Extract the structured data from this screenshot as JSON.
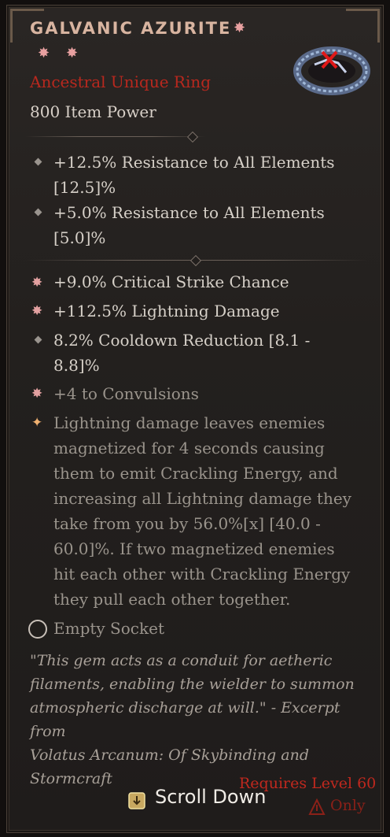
{
  "item": {
    "name": "GALVANIC AZURITE",
    "rarity": "Ancestral Unique Ring",
    "power": "800 Item Power"
  },
  "resistances": [
    {
      "line1": "+12.5% Resistance to All Elements",
      "line2": "[12.5]%"
    },
    {
      "line1": "+5.0% Resistance to All Elements",
      "line2": "[5.0]%"
    }
  ],
  "affixes": {
    "crit": "+9.0% Critical Strike Chance",
    "lightning": "+112.5% Lightning Damage",
    "cdr_line1": "8.2% Cooldown Reduction [8.1 -",
    "cdr_line2": "8.8]%",
    "convulsions": "+4 to Convulsions"
  },
  "unique_power": [
    "Lightning damage leaves enemies",
    "magnetized for 4 seconds causing",
    "them to emit Crackling Energy, and",
    "increasing all Lightning damage they",
    "take from you by 56.0%[x] [40.0 -",
    "60.0]%. If two magnetized enemies",
    "hit each other with Crackling Energy",
    "they pull each other together."
  ],
  "socket": "Empty Socket",
  "flavor": [
    "\"This gem acts as a conduit for aetheric",
    "filaments, enabling the wielder to summon",
    "atmospheric discharge at will.\" - Excerpt from",
    "Volatus Arcanum: Of Skybinding and",
    "Stormcraft"
  ],
  "requirements": {
    "level": "Requires Level 60",
    "class_only": "Only"
  },
  "controls": {
    "scroll": "Scroll Down"
  },
  "icons": {
    "ring": "ring-icon",
    "star": "star-icon",
    "socket": "socket-icon",
    "scroll": "scroll-icon",
    "class": "class-icon"
  },
  "colors": {
    "rarity": "#b8281e",
    "requirement": "#c0281e",
    "title": "#d8b4a0"
  }
}
